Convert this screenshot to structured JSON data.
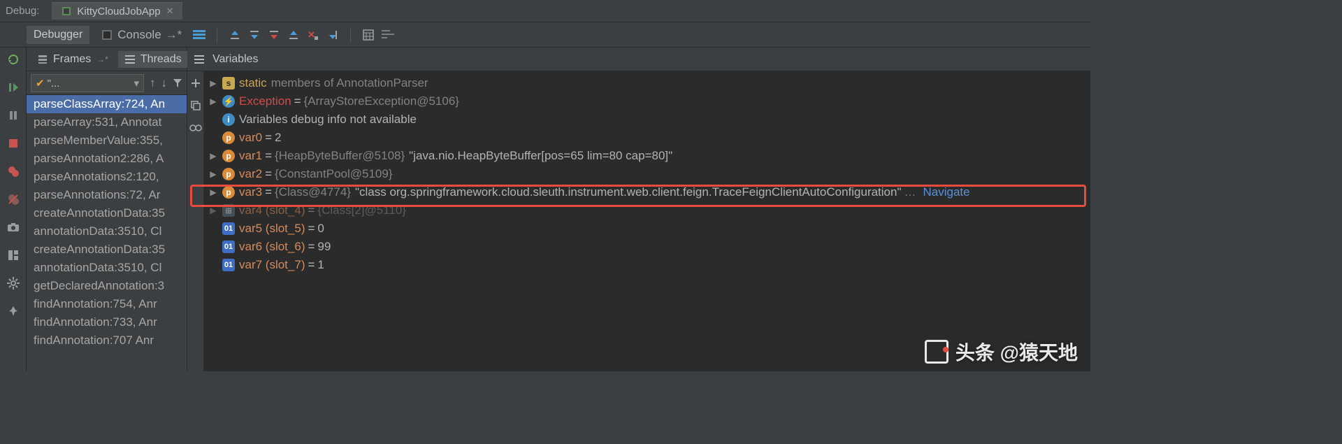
{
  "topbar": {
    "label": "Debug:",
    "tab": "KittyCloudJobApp"
  },
  "toolbar": {
    "debugger": "Debugger",
    "console": "Console"
  },
  "panels": {
    "frames": "Frames",
    "threads": "Threads",
    "variables": "Variables"
  },
  "combo": {
    "text": "\"..."
  },
  "frames": [
    "parseClassArray:724, An",
    "parseArray:531, Annotat",
    "parseMemberValue:355,",
    "parseAnnotation2:286, A",
    "parseAnnotations2:120,",
    "parseAnnotations:72, Ar",
    "createAnnotationData:35",
    "annotationData:3510, Cl",
    "createAnnotationData:35",
    "annotationData:3510, Cl",
    "getDeclaredAnnotation:3",
    "findAnnotation:754, Anr",
    "findAnnotation:733, Anr",
    "findAnnotation:707 Anr"
  ],
  "selected_frame_index": 0,
  "vars": {
    "static_label": "static",
    "static_suffix": "members of AnnotationParser",
    "exception": {
      "name": "Exception",
      "value": "{ArrayStoreException@5106}"
    },
    "info": "Variables debug info not available",
    "var0": {
      "name": "var0",
      "value": "2"
    },
    "var1": {
      "name": "var1",
      "type": "{HeapByteBuffer@5108}",
      "str": "\"java.nio.HeapByteBuffer[pos=65 lim=80 cap=80]\""
    },
    "var2": {
      "name": "var2",
      "type": "{ConstantPool@5109}"
    },
    "var3": {
      "name": "var3",
      "type": "{Class@4774}",
      "str": "\"class org.springframework.cloud.sleuth.instrument.web.client.feign.TraceFeignClientAutoConfiguration\"",
      "link": "Navigate"
    },
    "var4": {
      "name": "var4 (slot_4)",
      "type": "{Class[2]@5110}"
    },
    "var5": {
      "name": "var5 (slot_5)",
      "value": "0"
    },
    "var6": {
      "name": "var6 (slot_6)",
      "value": "99"
    },
    "var7": {
      "name": "var7 (slot_7)",
      "value": "1"
    }
  },
  "watermark": "头条 @猿天地"
}
